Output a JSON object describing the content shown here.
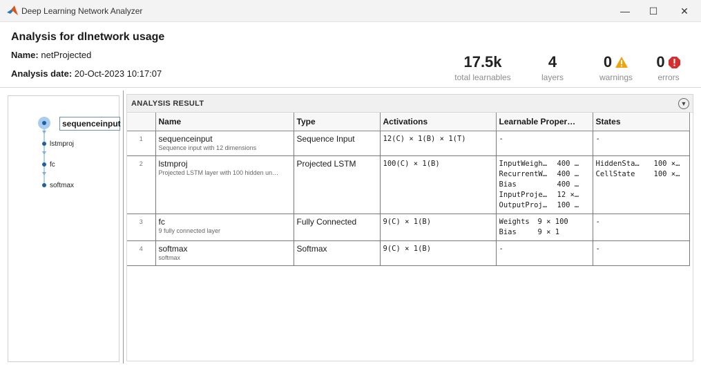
{
  "window": {
    "title": "Deep Learning Network Analyzer",
    "minimize_glyph": "—",
    "maximize_glyph": "☐",
    "close_glyph": "✕"
  },
  "header": {
    "title": "Analysis for dlnetwork usage",
    "name_label": "Name:",
    "name_value": "netProjected",
    "date_label": "Analysis date:",
    "date_value": "20-Oct-2023 10:17:07"
  },
  "stats": {
    "learnables": {
      "value": "17.5k",
      "label": "total learnables"
    },
    "layers": {
      "value": "4",
      "label": "layers"
    },
    "warnings": {
      "value": "0",
      "label": "warnings"
    },
    "errors": {
      "value": "0",
      "label": "errors"
    }
  },
  "graph": {
    "nodes": [
      "sequenceinput",
      "lstmproj",
      "fc",
      "softmax"
    ]
  },
  "result": {
    "title": "ANALYSIS RESULT",
    "columns": [
      "",
      "Name",
      "Type",
      "Activations",
      "Learnable Proper…",
      "States"
    ],
    "rows": [
      {
        "index": "1",
        "name": "sequenceinput",
        "desc": "Sequence input with 12 dimensions",
        "type": "Sequence Input",
        "activations": "12(C) × 1(B) × 1(T)",
        "learnables": [
          {
            "k": "-",
            "v": ""
          }
        ],
        "states": [
          {
            "k": "-",
            "v": ""
          }
        ]
      },
      {
        "index": "2",
        "name": "lstmproj",
        "desc": "Projected LSTM layer with 100 hidden un…",
        "type": "Projected LSTM",
        "activations": "100(C) × 1(B)",
        "learnables": [
          {
            "k": "InputWeigh…",
            "v": "400 …"
          },
          {
            "k": "RecurrentW…",
            "v": "400 …"
          },
          {
            "k": "Bias",
            "v": "400 …"
          },
          {
            "k": "InputProje…",
            "v": "12 ×…"
          },
          {
            "k": "OutputProj…",
            "v": "100 …"
          }
        ],
        "states": [
          {
            "k": "HiddenSta…",
            "v": "100 ×…"
          },
          {
            "k": "CellState",
            "v": "100 ×…"
          }
        ]
      },
      {
        "index": "3",
        "name": "fc",
        "desc": "9 fully connected layer",
        "type": "Fully Connected",
        "activations": "9(C) × 1(B)",
        "learnables": [
          {
            "k": "Weights",
            "v": "9 × 100"
          },
          {
            "k": "Bias",
            "v": "9 × 1"
          }
        ],
        "states": [
          {
            "k": "-",
            "v": ""
          }
        ]
      },
      {
        "index": "4",
        "name": "softmax",
        "desc": "softmax",
        "type": "Softmax",
        "activations": "9(C) × 1(B)",
        "learnables": [
          {
            "k": "-",
            "v": ""
          }
        ],
        "states": [
          {
            "k": "-",
            "v": ""
          }
        ]
      }
    ]
  },
  "colors": {
    "warning": "#f0a30a",
    "error": "#d32f2f",
    "node": "#1f5fa6",
    "node_halo": "#a9cdee"
  }
}
